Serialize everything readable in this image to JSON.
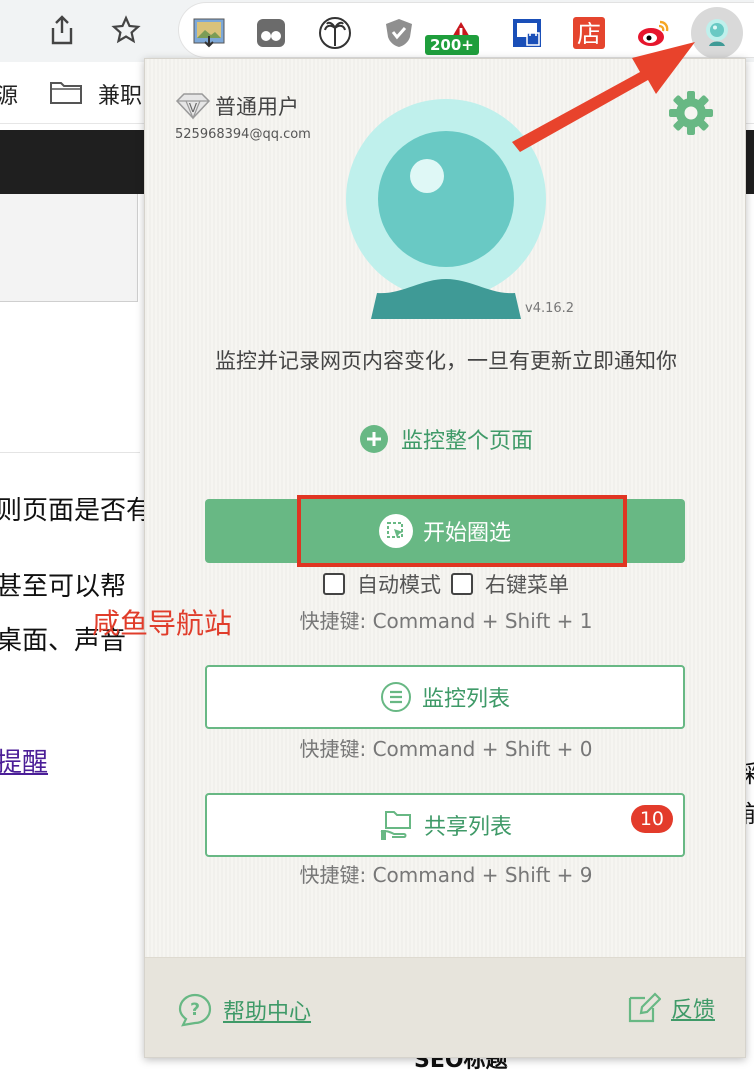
{
  "toolbar": {
    "share_icon": "share-icon",
    "bookmark_icon": "star-icon",
    "extensions": [
      {
        "name": "image-download-icon"
      },
      {
        "name": "reader-glasses-icon"
      },
      {
        "name": "palm-tree-icon"
      },
      {
        "name": "shield-check-icon"
      },
      {
        "name": "warning-icon",
        "badge": "200+"
      },
      {
        "name": "lock-window-icon"
      },
      {
        "name": "store-icon",
        "text": "店"
      },
      {
        "name": "weibo-icon"
      },
      {
        "name": "monitor-extension-icon"
      }
    ]
  },
  "bookmarks": {
    "partial_left": "源",
    "folder_label": "兼职"
  },
  "page": {
    "line1": "则页面是否有",
    "line2": "甚至可以帮",
    "line3": "桌面、声音",
    "link": "提醒",
    "seo": "SEO标题",
    "right_partial_1": "彩",
    "right_partial_2": "前"
  },
  "watermark": "咸鱼导航站",
  "popup": {
    "user_level": "普通用户",
    "user_email": "525968394@qq.com",
    "version": "v4.16.2",
    "tagline": "监控并记录网页内容变化，一旦有更新立即通知你",
    "monitor_whole_page": "监控整个页面",
    "start_select": "开始圈选",
    "auto_mode": "自动模式",
    "right_click_menu": "右键菜单",
    "shortcut_start": "快捷键: Command + Shift + 1",
    "monitor_list": "监控列表",
    "shortcut_list": "快捷键: Command + Shift + 0",
    "shared_list": "共享列表",
    "shared_badge": "10",
    "shortcut_shared": "快捷键: Command + Shift + 9",
    "help": "帮助中心",
    "feedback": "反馈"
  },
  "colors": {
    "accent_green": "#68b884",
    "annotation_red": "#e03522",
    "logo_teal": "#69c9c4"
  }
}
